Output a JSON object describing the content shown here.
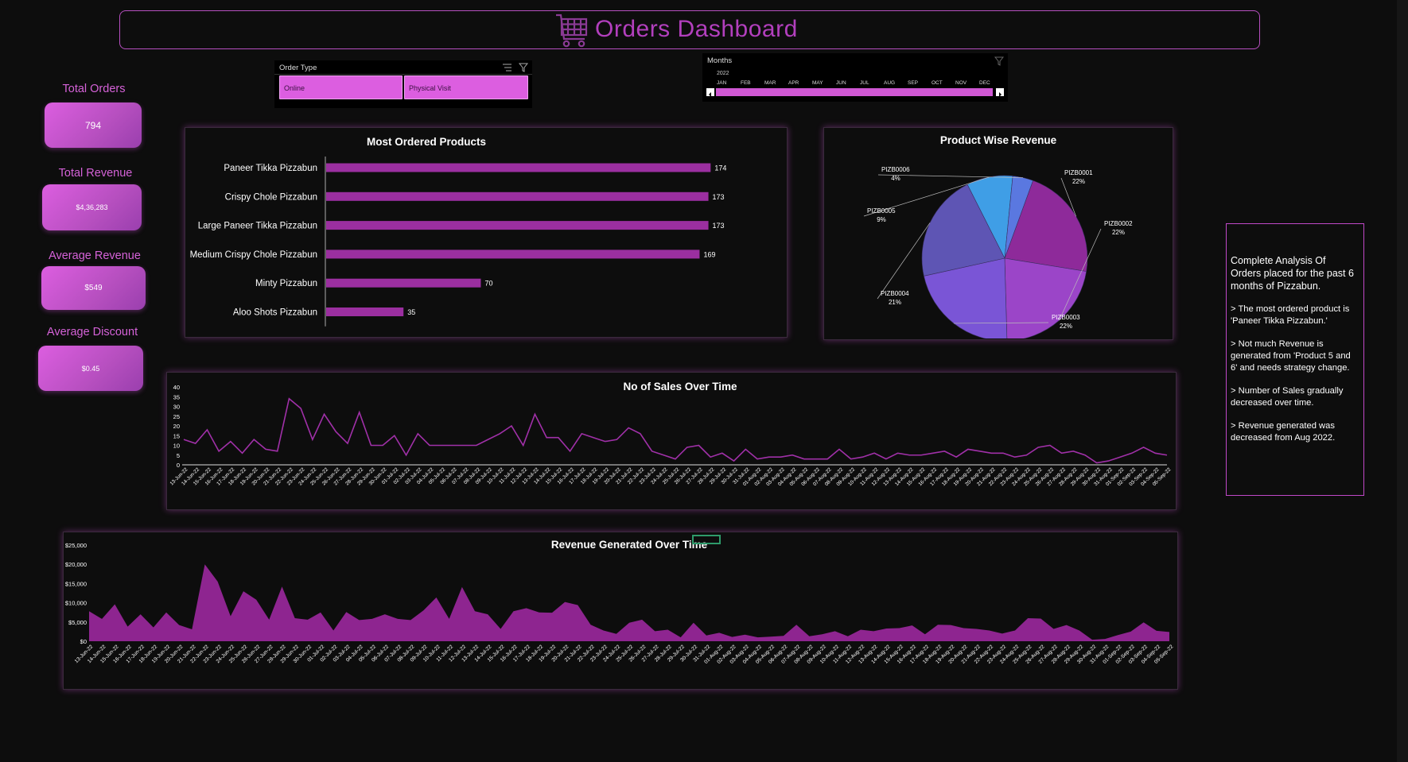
{
  "title": "Orders Dashboard",
  "kpis": {
    "total_orders": {
      "label": "Total Orders",
      "value": "794"
    },
    "total_revenue": {
      "label": "Total Revenue",
      "value": "$4,36,283"
    },
    "average_revenue": {
      "label": "Average Revenue",
      "value": "$549"
    },
    "average_discount": {
      "label": "Average Discount",
      "value": "$0.45"
    }
  },
  "order_type_slicer": {
    "title": "Order Type",
    "options": [
      "Online",
      "Physical Visit"
    ]
  },
  "months_slicer": {
    "title": "Months",
    "year": "2022",
    "months": [
      "JAN",
      "FEB",
      "MAR",
      "APR",
      "MAY",
      "JUN",
      "JUL",
      "AUG",
      "SEP",
      "OCT",
      "NOV",
      "DEC"
    ]
  },
  "notes": {
    "intro": "Complete Analysis Of Orders placed  for the past 6 months of Pizzabun.",
    "points": [
      ">  The most ordered product is 'Paneer Tikka Pizzabun.'",
      ">  Not much Revenue is generated from 'Product 5 and 6' and needs strategy change.",
      "> Number of Sales gradually decreased over time.",
      "> Revenue generated was decreased  from Aug 2022."
    ]
  },
  "colors": {
    "accent": "#b23fbd",
    "kpi": "#dc5ee0",
    "bar": "#9b2fa0",
    "line": "#a030a8",
    "area": "#8e2590"
  },
  "chart_data": [
    {
      "type": "bar",
      "title": "Most Ordered Products",
      "categories": [
        "Paneer Tikka Pizzabun",
        "Crispy Chole Pizzabun",
        "Large Paneer Tikka Pizzabun",
        "Medium Crispy Chole Pizzabun",
        "Minty Pizzabun",
        "Aloo Shots Pizzabun"
      ],
      "values": [
        174,
        173,
        173,
        169,
        70,
        35
      ],
      "orientation": "horizontal",
      "xlim": [
        0,
        180
      ]
    },
    {
      "type": "pie",
      "title": "Product Wise Revenue",
      "labels": [
        "PIZB0001",
        "PIZB0002",
        "PIZB0003",
        "PIZB0004",
        "PIZB0005",
        "PIZB0006"
      ],
      "values": [
        22,
        22,
        22,
        21,
        9,
        4
      ],
      "value_labels": [
        "22%",
        "22%",
        "22%",
        "21%",
        "9%",
        "4%"
      ],
      "colors": [
        "#8e2a9a",
        "#9b45c8",
        "#7a55d6",
        "#5e55b4",
        "#3f9ee6",
        "#5a78e0"
      ]
    },
    {
      "type": "line",
      "title": "No of Sales Over Time",
      "x": [
        "13-Jun-22",
        "14-Jun-22",
        "15-Jun-22",
        "16-Jun-22",
        "17-Jun-22",
        "18-Jun-22",
        "19-Jun-22",
        "20-Jun-22",
        "21-Jun-22",
        "22-Jun-22",
        "23-Jun-22",
        "24-Jun-22",
        "25-Jun-22",
        "26-Jun-22",
        "27-Jun-22",
        "28-Jun-22",
        "29-Jun-22",
        "30-Jun-22",
        "01-Jul-22",
        "02-Jul-22",
        "03-Jul-22",
        "04-Jul-22",
        "05-Jul-22",
        "06-Jul-22",
        "07-Jul-22",
        "08-Jul-22",
        "09-Jul-22",
        "10-Jul-22",
        "11-Jul-22",
        "12-Jul-22",
        "13-Jul-22",
        "14-Jul-22",
        "15-Jul-22",
        "16-Jul-22",
        "17-Jul-22",
        "18-Jul-22",
        "19-Jul-22",
        "20-Jul-22",
        "21-Jul-22",
        "22-Jul-22",
        "23-Jul-22",
        "24-Jul-22",
        "25-Jul-22",
        "26-Jul-22",
        "27-Jul-22",
        "28-Jul-22",
        "29-Jul-22",
        "30-Jul-22",
        "31-Jul-22",
        "01-Aug-22",
        "02-Aug-22",
        "03-Aug-22",
        "04-Aug-22",
        "05-Aug-22",
        "06-Aug-22",
        "07-Aug-22",
        "08-Aug-22",
        "09-Aug-22",
        "10-Aug-22",
        "11-Aug-22",
        "12-Aug-22",
        "13-Aug-22",
        "14-Aug-22",
        "15-Aug-22",
        "16-Aug-22",
        "17-Aug-22",
        "18-Aug-22",
        "19-Aug-22",
        "20-Aug-22",
        "21-Aug-22",
        "22-Aug-22",
        "23-Aug-22",
        "24-Aug-22",
        "25-Aug-22",
        "26-Aug-22",
        "27-Aug-22",
        "28-Aug-22",
        "29-Aug-22",
        "30-Aug-22",
        "31-Aug-22",
        "01-Sep-22",
        "02-Sep-22",
        "03-Sep-22",
        "04-Sep-22",
        "05-Sep-22",
        "06-Sep-22"
      ],
      "values": [
        13,
        11,
        18,
        7,
        12,
        6,
        13,
        8,
        7,
        34,
        29,
        13,
        26,
        17,
        11,
        27,
        10,
        10,
        15,
        5,
        16,
        10,
        10,
        10,
        10,
        10,
        13,
        16,
        20,
        10,
        26,
        14,
        14,
        7,
        16,
        14,
        12,
        13,
        19,
        16,
        7,
        5,
        3,
        9,
        10,
        4,
        6,
        2,
        8,
        3,
        4,
        4,
        5,
        3,
        3,
        3,
        8,
        3,
        4,
        6,
        3,
        6,
        5,
        5,
        6,
        7,
        4,
        8,
        7,
        6,
        6,
        4,
        5,
        9,
        10,
        6,
        7,
        5,
        1,
        2,
        4,
        6,
        9,
        6,
        5
      ],
      "ylim": [
        0,
        40
      ],
      "yticks": [
        0,
        5,
        10,
        15,
        20,
        25,
        30,
        35,
        40
      ]
    },
    {
      "type": "area",
      "title": "Revenue Generated Over Time",
      "x": [
        "13-Jun-22",
        "14-Jun-22",
        "15-Jun-22",
        "16-Jun-22",
        "17-Jun-22",
        "18-Jun-22",
        "19-Jun-22",
        "20-Jun-22",
        "21-Jun-22",
        "22-Jun-22",
        "23-Jun-22",
        "24-Jun-22",
        "25-Jun-22",
        "26-Jun-22",
        "27-Jun-22",
        "28-Jun-22",
        "29-Jun-22",
        "30-Jun-22",
        "01-Jul-22",
        "02-Jul-22",
        "03-Jul-22",
        "04-Jul-22",
        "05-Jul-22",
        "06-Jul-22",
        "07-Jul-22",
        "08-Jul-22",
        "09-Jul-22",
        "10-Jul-22",
        "11-Jul-22",
        "12-Jul-22",
        "13-Jul-22",
        "14-Jul-22",
        "15-Jul-22",
        "16-Jul-22",
        "17-Jul-22",
        "18-Jul-22",
        "19-Jul-22",
        "20-Jul-22",
        "21-Jul-22",
        "22-Jul-22",
        "23-Jul-22",
        "24-Jul-22",
        "25-Jul-22",
        "26-Jul-22",
        "27-Jul-22",
        "28-Jul-22",
        "29-Jul-22",
        "30-Jul-22",
        "31-Jul-22",
        "01-Aug-22",
        "02-Aug-22",
        "03-Aug-22",
        "04-Aug-22",
        "05-Aug-22",
        "06-Aug-22",
        "07-Aug-22",
        "08-Aug-22",
        "09-Aug-22",
        "10-Aug-22",
        "11-Aug-22",
        "12-Aug-22",
        "13-Aug-22",
        "14-Aug-22",
        "15-Aug-22",
        "16-Aug-22",
        "17-Aug-22",
        "18-Aug-22",
        "19-Aug-22",
        "20-Aug-22",
        "21-Aug-22",
        "22-Aug-22",
        "23-Aug-22",
        "24-Aug-22",
        "25-Aug-22",
        "26-Aug-22",
        "27-Aug-22",
        "28-Aug-22",
        "29-Aug-22",
        "30-Aug-22",
        "31-Aug-22",
        "01-Sep-22",
        "02-Sep-22",
        "03-Sep-22",
        "04-Sep-22",
        "05-Sep-22",
        "06-Sep-22"
      ],
      "values": [
        7800,
        5800,
        9600,
        3800,
        7000,
        3600,
        7500,
        4200,
        3100,
        20000,
        15500,
        6500,
        13000,
        10800,
        5600,
        14200,
        6000,
        5600,
        7500,
        2800,
        7600,
        5500,
        5800,
        7000,
        5800,
        5500,
        8000,
        11400,
        5800,
        14100,
        7800,
        7000,
        3200,
        7800,
        8600,
        7500,
        7400,
        10200,
        9400,
        4300,
        2800,
        1900,
        4800,
        5600,
        2600,
        3000,
        1000,
        4800,
        1500,
        2200,
        1100,
        1700,
        1000,
        1200,
        1400,
        4300,
        1300,
        1800,
        2600,
        1300,
        3000,
        2600,
        3300,
        3400,
        4100,
        1800,
        4300,
        4200,
        3400,
        3200,
        2800,
        2000,
        2800,
        6000,
        5900,
        3200,
        4200,
        2800,
        400,
        600,
        1600,
        2500,
        4900,
        2700,
        2400
      ],
      "ylim": [
        0,
        25000
      ],
      "yticks": [
        "$0",
        "$5,000",
        "$10,000",
        "$15,000",
        "$20,000",
        "$25,000"
      ]
    }
  ]
}
